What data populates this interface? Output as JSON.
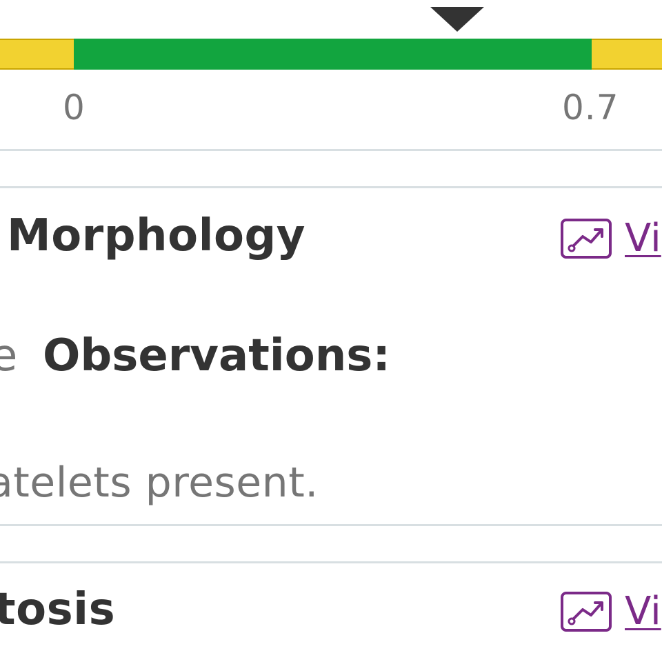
{
  "range": {
    "low_label": "0",
    "high_label": "0.7",
    "value_fraction_of_normal": 0.74,
    "colors": {
      "normal": "#12a53f",
      "out_of_range": "#f2d230",
      "marker": "#333333"
    }
  },
  "morphology_row": {
    "title": "Morphology",
    "view_link_label": "Vi",
    "icon": "trend-chart-icon"
  },
  "observations": {
    "lead_fragment": "e",
    "label": "Observations:",
    "text": "atelets present."
  },
  "next_row": {
    "title": "tosis",
    "view_link_label": "Vi",
    "icon": "trend-chart-icon"
  },
  "theme": {
    "link_color": "#7b2a88",
    "divider_color": "#d8dfe2",
    "heading_color": "#333333",
    "muted_text_color": "#767676"
  }
}
